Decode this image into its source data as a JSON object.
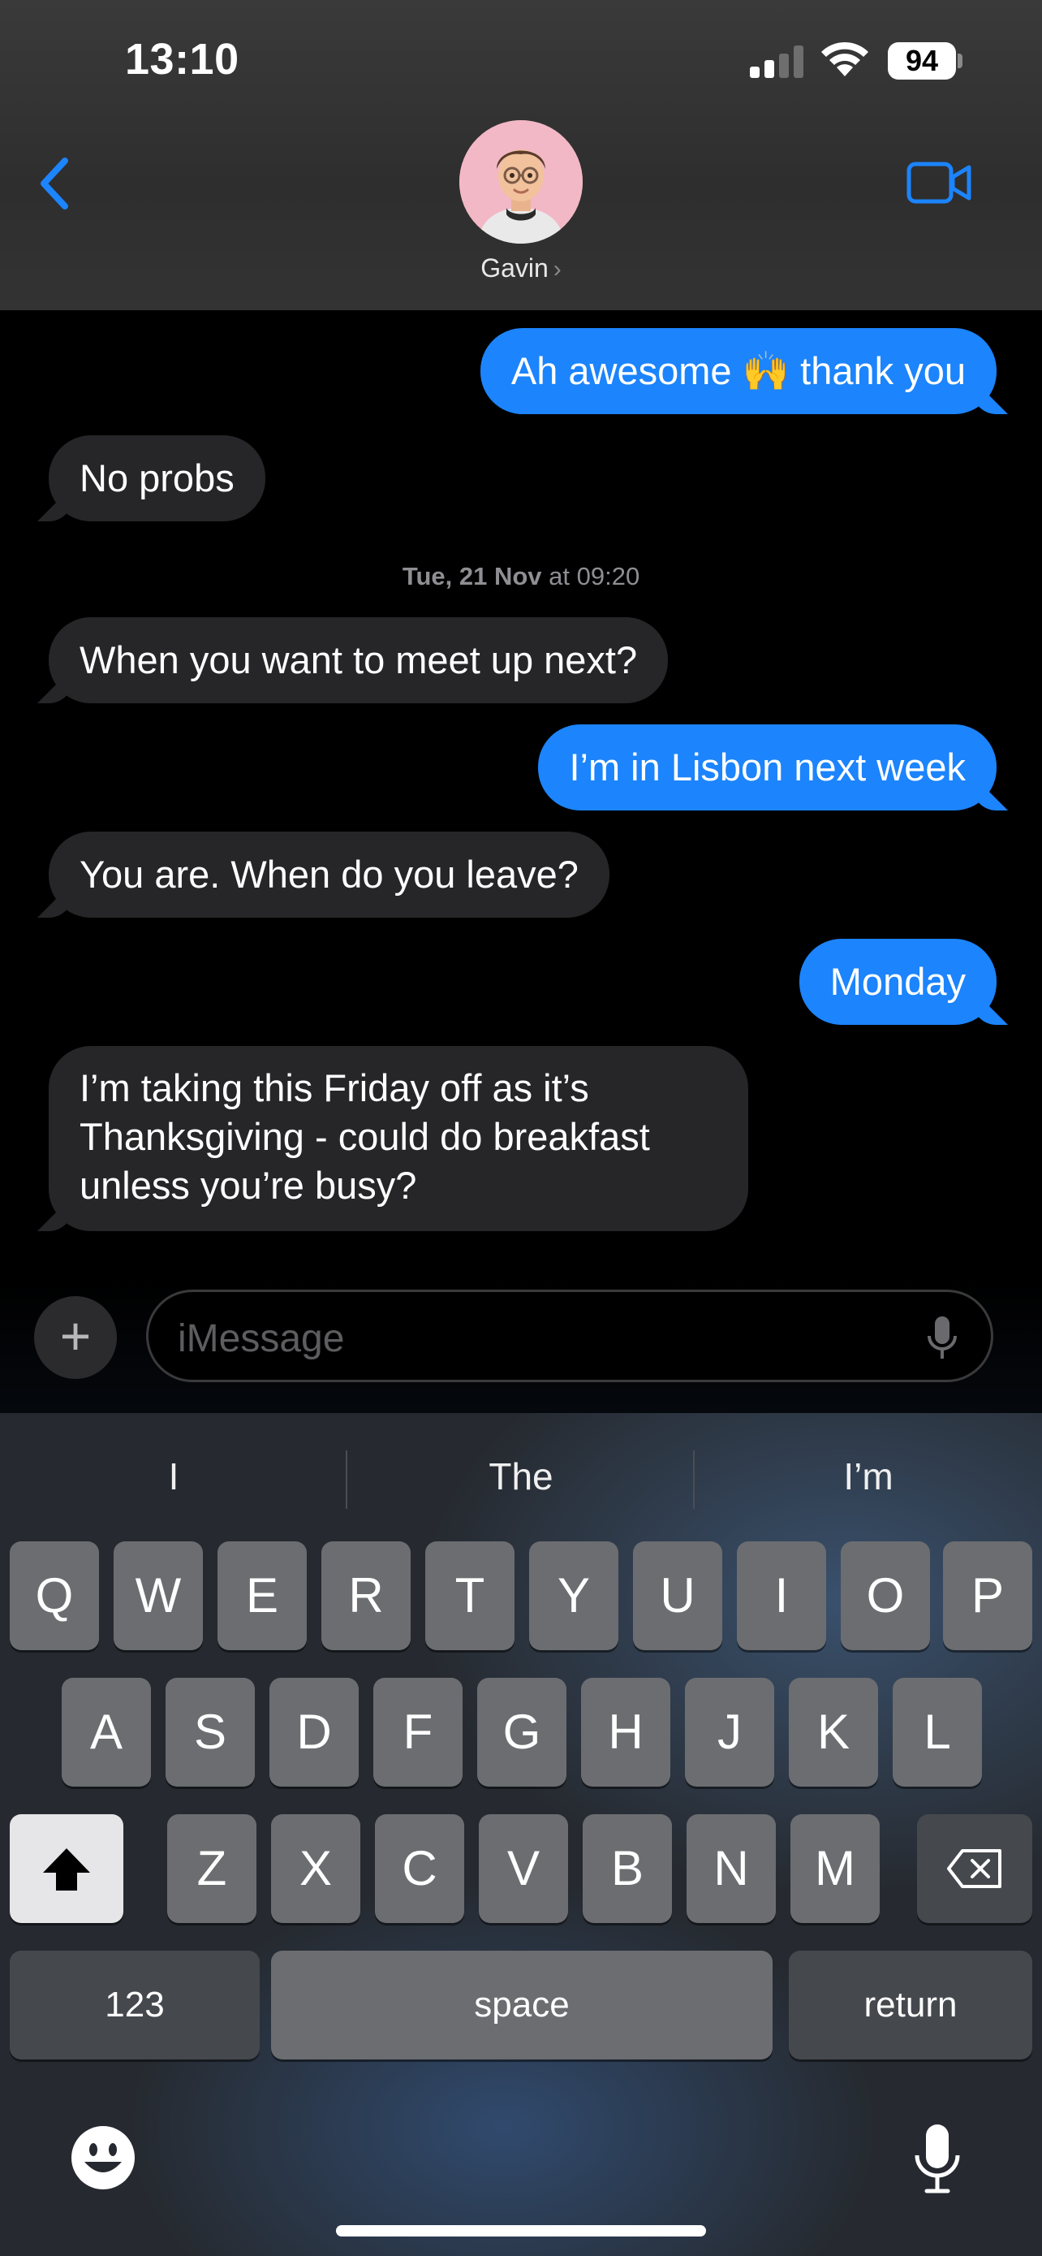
{
  "status_bar": {
    "time": "13:10",
    "battery": "94"
  },
  "header": {
    "contact_name": "Gavin",
    "name_chevron": "›",
    "back_icon": "chevron-left-icon",
    "video_icon": "video-camera-icon",
    "accent_color": "#1c84fc"
  },
  "messages": [
    {
      "dir": "out",
      "text": "Ah awesome 🙌 thank you"
    },
    {
      "dir": "in",
      "text": "No probs"
    },
    {
      "dir": "in",
      "text": "When you want to meet up next?"
    },
    {
      "dir": "out",
      "text": "I’m in Lisbon next week"
    },
    {
      "dir": "in",
      "text": "You are. When do you leave?"
    },
    {
      "dir": "out",
      "text": "Monday"
    },
    {
      "dir": "in",
      "text": "I’m taking this Friday off as it’s Thanksgiving - could do breakfast unless you’re busy?"
    }
  ],
  "timestamp": {
    "day": "Tue, 21 Nov",
    "time": "at 09:20"
  },
  "composer": {
    "placeholder": "iMessage",
    "plus_label": "+"
  },
  "keyboard": {
    "suggestions": [
      "I",
      "The",
      "I’m"
    ],
    "row1": [
      "Q",
      "W",
      "E",
      "R",
      "T",
      "Y",
      "U",
      "I",
      "O",
      "P"
    ],
    "row2": [
      "A",
      "S",
      "D",
      "F",
      "G",
      "H",
      "J",
      "K",
      "L"
    ],
    "row3": [
      "Z",
      "X",
      "C",
      "V",
      "B",
      "N",
      "M"
    ],
    "numbers_label": "123",
    "space_label": "space",
    "return_label": "return"
  }
}
